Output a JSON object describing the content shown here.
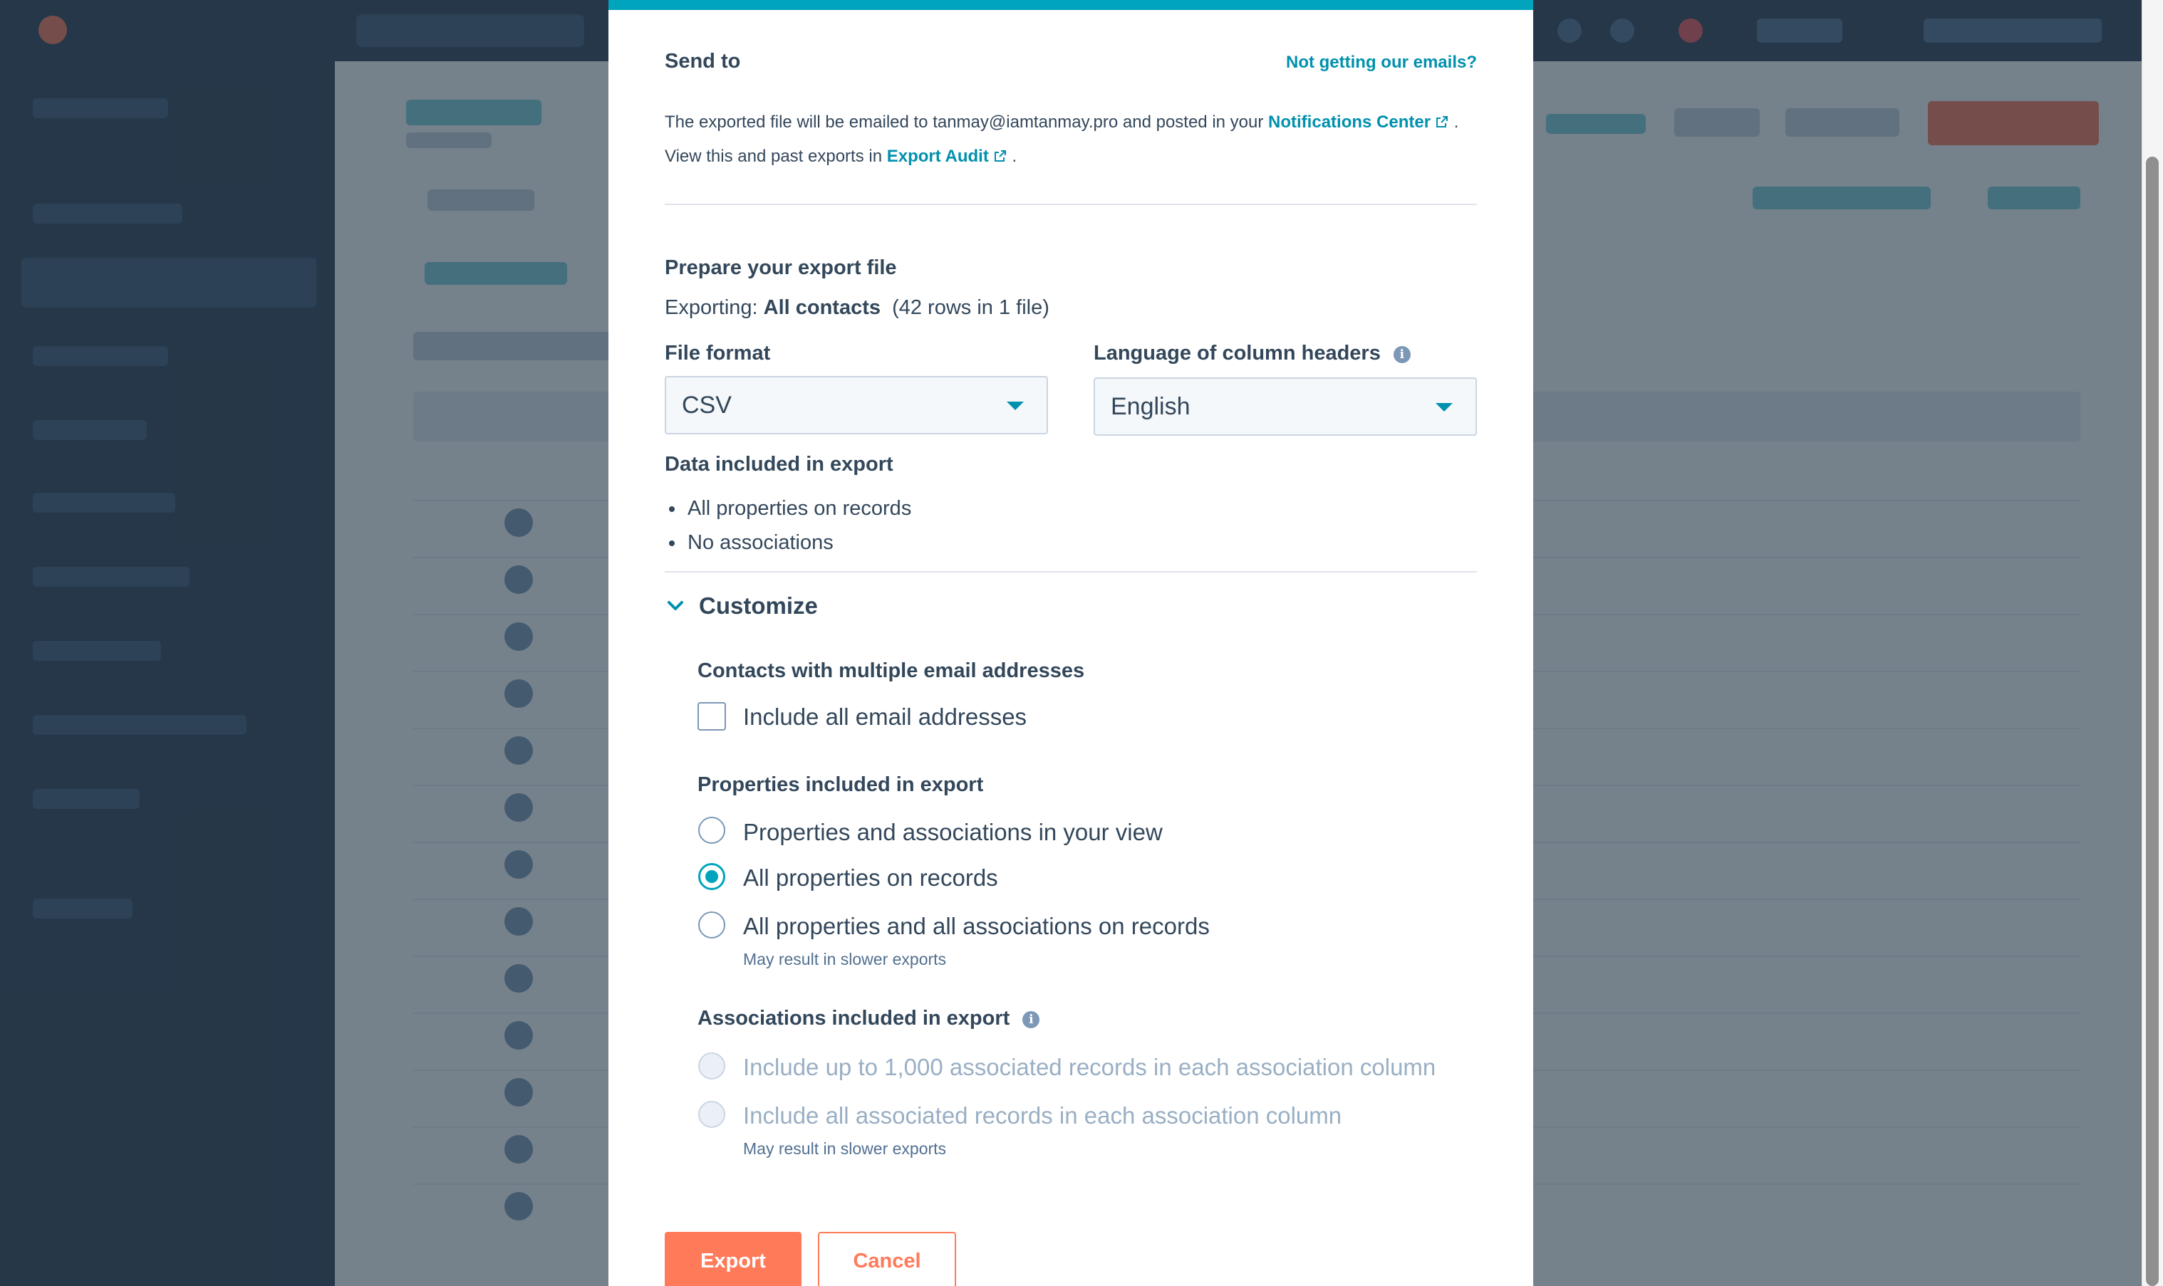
{
  "modal": {
    "send_to": {
      "heading": "Send to",
      "help_link": "Not getting our emails?",
      "info_part1": "The exported file will be emailed to tanmay@iamtanmay.pro and posted in your",
      "notifications_link": "Notifications Center",
      "info_part2": ". View this and past exports in",
      "audit_link": "Export Audit",
      "info_part3": "."
    },
    "prepare": {
      "heading": "Prepare your export file",
      "exporting_label": "Exporting:",
      "exporting_target": "All contacts",
      "exporting_count": "(42 rows in 1 file)"
    },
    "file_format": {
      "label": "File format",
      "value": "CSV"
    },
    "language": {
      "label": "Language of column headers",
      "value": "English"
    },
    "data_included": {
      "label": "Data included in export",
      "items": [
        "All properties on records",
        "No associations"
      ]
    },
    "customize": {
      "label": "Customize",
      "multiple_emails": {
        "heading": "Contacts with multiple email addresses",
        "checkbox_label": "Include all email addresses",
        "checked": false
      },
      "properties": {
        "heading": "Properties included in export",
        "options": [
          {
            "label": "Properties and associations in your view",
            "checked": false
          },
          {
            "label": "All properties on records",
            "checked": true
          },
          {
            "label": "All properties and all associations on records",
            "checked": false,
            "note": "May result in slower exports"
          }
        ]
      },
      "associations": {
        "heading": "Associations included in export",
        "options": [
          {
            "label": "Include up to 1,000 associated records in each association column",
            "disabled": true
          },
          {
            "label": "Include all associated records in each association column",
            "disabled": true,
            "note": "May result in slower exports"
          }
        ]
      }
    },
    "buttons": {
      "export": "Export",
      "cancel": "Cancel"
    }
  },
  "colors": {
    "accent": "#00a4bd",
    "link": "#0091ae",
    "primary_button": "#ff7a59",
    "text": "#33475b",
    "disabled_text": "#99afc4"
  },
  "icons": [
    "external-link-icon",
    "info-icon",
    "chevron-down-icon",
    "dropdown-caret-icon"
  ]
}
